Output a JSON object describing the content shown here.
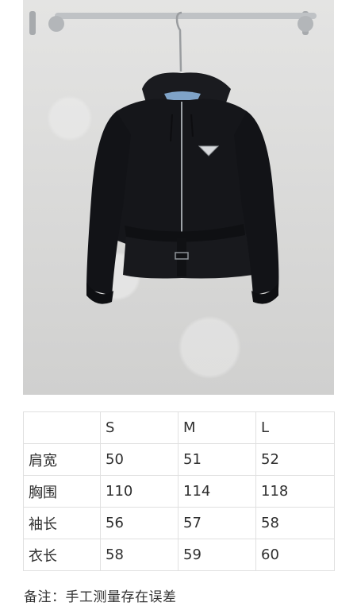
{
  "product_image": {
    "alt_subject": "black-hooded-zip-jacket",
    "colors": {
      "background": "#dcdcdb",
      "jacket": "#15161a",
      "rail": "#b9bcbf",
      "hood_lining": "#7fa3c8"
    }
  },
  "size_table": {
    "headers": [
      "",
      "S",
      "M",
      "L"
    ],
    "rows": [
      {
        "label": "肩宽",
        "values": [
          "50",
          "51",
          "52"
        ]
      },
      {
        "label": "胸围",
        "values": [
          "110",
          "114",
          "118"
        ]
      },
      {
        "label": "袖长",
        "values": [
          "56",
          "57",
          "58"
        ]
      },
      {
        "label": "衣长",
        "values": [
          "58",
          "59",
          "60"
        ]
      }
    ]
  },
  "note": "备注：手工测量存在误差"
}
